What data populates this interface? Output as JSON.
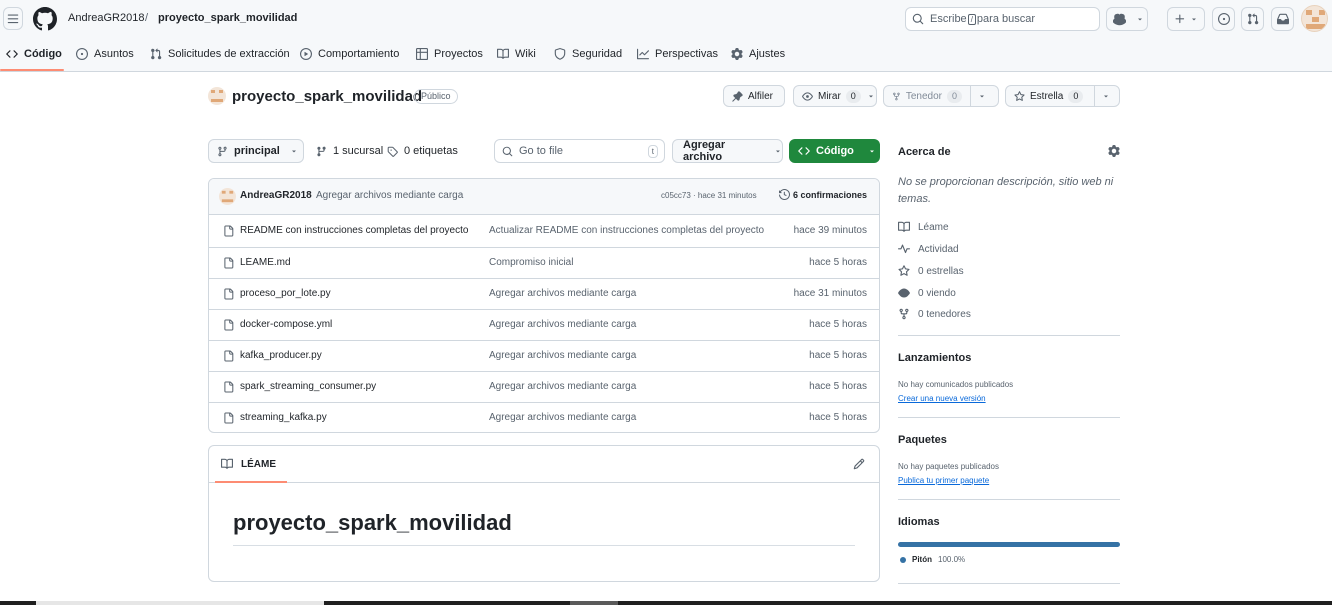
{
  "header": {
    "owner": "AndreaGR2018",
    "separator": "/",
    "repo": "proyecto_spark_movilidad",
    "search_prefix": "Escribe",
    "search_key": "/",
    "search_suffix": "para buscar"
  },
  "repo_nav": [
    {
      "label": "Código"
    },
    {
      "label": "Asuntos"
    },
    {
      "label": "Solicitudes de extracción"
    },
    {
      "label": "Comportamiento"
    },
    {
      "label": "Proyectos"
    },
    {
      "label": "Wiki"
    },
    {
      "label": "Seguridad"
    },
    {
      "label": "Perspectivas"
    },
    {
      "label": "Ajustes"
    }
  ],
  "repo": {
    "name": "proyecto_spark_movilidad",
    "visibility": "Público",
    "pin_label": "Alfiler",
    "watch_label": "Mirar",
    "watch_count": "0",
    "fork_label": "Tenedor",
    "fork_count": "0",
    "star_label": "Estrella",
    "star_count": "0"
  },
  "branch_bar": {
    "branch": "principal",
    "branches": "1 sucursal",
    "tags": "0 etiquetas",
    "goto_placeholder": "Go to file",
    "goto_key": "t",
    "add_file": "Agregar archivo",
    "code": "Código"
  },
  "latest_commit": {
    "author": "AndreaGR2018",
    "message": "Agregar archivos mediante carga",
    "hash_time": "c05cc73 · hace 31 minutos",
    "commits": "6 confirmaciones"
  },
  "files": [
    {
      "name": "README con instrucciones completas del proyecto",
      "message": "Actualizar README con instrucciones completas del proyecto",
      "time": "hace 39 minutos"
    },
    {
      "name": "LÉAME.md",
      "message": "Compromiso inicial",
      "time": "hace 5 horas"
    },
    {
      "name": "proceso_por_lote.py",
      "message": "Agregar archivos mediante carga",
      "time": "hace 31 minutos"
    },
    {
      "name": "docker-compose.yml",
      "message": "Agregar archivos mediante carga",
      "time": "hace 5 horas"
    },
    {
      "name": "kafka_producer.py",
      "message": "Agregar archivos mediante carga",
      "time": "hace 5 horas"
    },
    {
      "name": "spark_streaming_consumer.py",
      "message": "Agregar archivos mediante carga",
      "time": "hace 5 horas"
    },
    {
      "name": "streaming_kafka.py",
      "message": "Agregar archivos mediante carga",
      "time": "hace 5 horas"
    }
  ],
  "readme": {
    "tab": "LÉAME",
    "title": "proyecto_spark_movilidad"
  },
  "sidebar": {
    "about_title": "Acerca de",
    "about_desc": "No se proporcionan descripción, sitio web ni temas.",
    "links": [
      {
        "label": "Léame"
      },
      {
        "label": "Actividad"
      },
      {
        "label": "0 estrellas"
      },
      {
        "label": "0 viendo"
      },
      {
        "label": "0 tenedores"
      }
    ],
    "releases_title": "Lanzamientos",
    "releases_none": "No hay comunicados publicados",
    "releases_link": "Crear una nueva versión",
    "packages_title": "Paquetes",
    "packages_none": "No hay paquetes publicados",
    "packages_link": "Publica tu primer paquete",
    "languages_title": "Idiomas",
    "language_name": "Pitón",
    "language_percent": "100.0%",
    "language_color": "#3572a5"
  },
  "colors": {
    "primary_button": "#1f883d",
    "tab_underline": "#fd8c73",
    "link": "#0969da"
  }
}
